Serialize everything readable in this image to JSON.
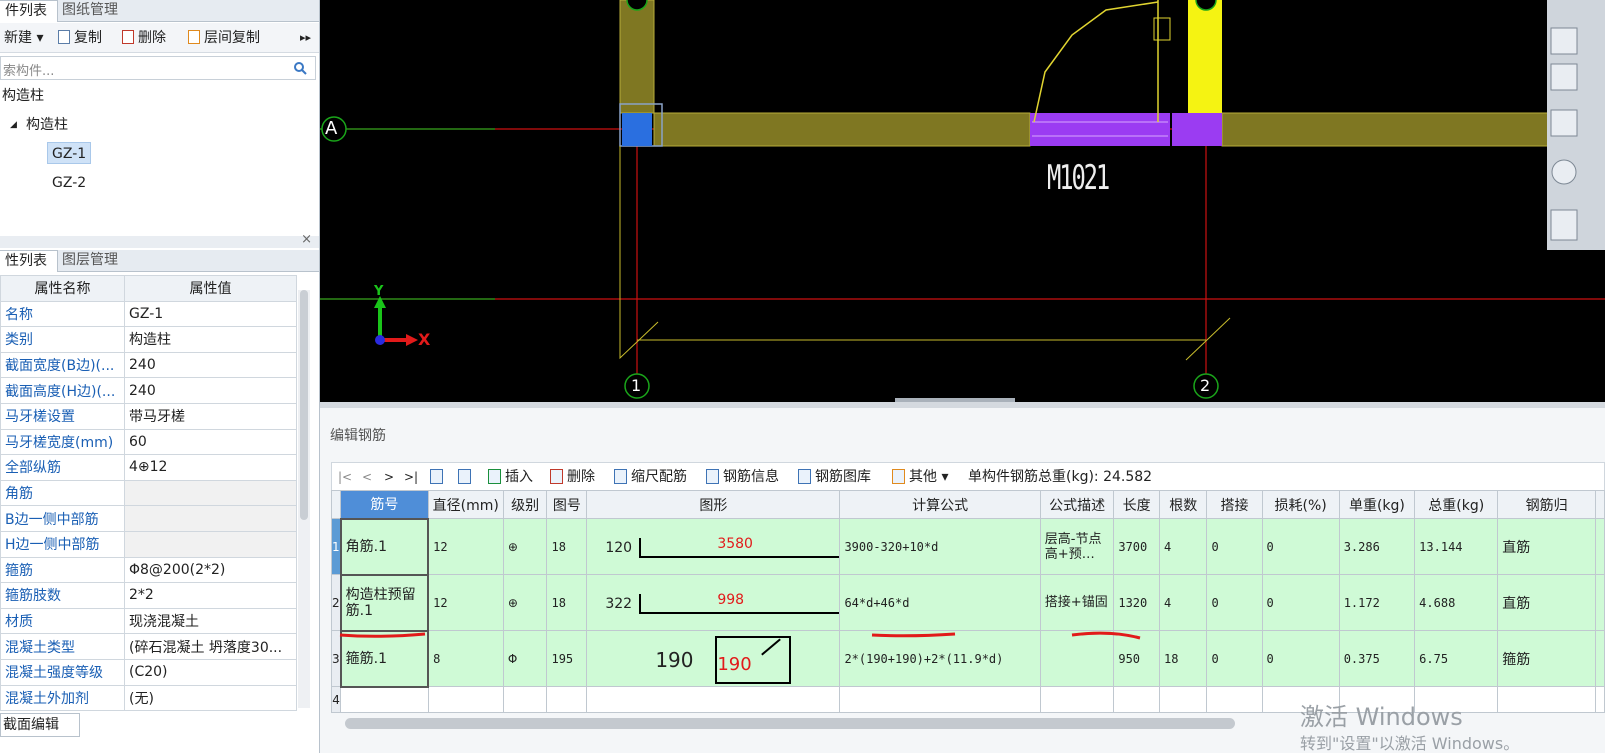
{
  "component_panel": {
    "tabs": [
      "件列表",
      "图纸管理"
    ],
    "toolbar": [
      {
        "label": "新建 ▾",
        "icon": "new-icon"
      },
      {
        "label": "复制",
        "icon": "copy-icon"
      },
      {
        "label": "删除",
        "icon": "delete-icon"
      },
      {
        "label": "层间复制",
        "icon": "floor-copy-icon"
      }
    ],
    "more": "▸▸",
    "search_placeholder": "索构件...",
    "tree": {
      "root": "构造柱",
      "group": "构造柱",
      "group_toggle": "◢",
      "items": [
        "GZ-1",
        "GZ-2"
      ]
    },
    "close": "×"
  },
  "property_panel": {
    "tabs": [
      "性列表",
      "图层管理"
    ],
    "headers": [
      "属性名称",
      "属性值"
    ],
    "rows": [
      {
        "name": "名称",
        "value": "GZ-1"
      },
      {
        "name": "类别",
        "value": "构造柱"
      },
      {
        "name": "截面宽度(B边)(...",
        "value": "240"
      },
      {
        "name": "截面高度(H边)(...",
        "value": "240"
      },
      {
        "name": "马牙槎设置",
        "value": "带马牙槎"
      },
      {
        "name": "马牙槎宽度(mm)",
        "value": "60"
      },
      {
        "name": "全部纵筋",
        "value": "4⊕12"
      },
      {
        "name": "角筋",
        "value": ""
      },
      {
        "name": "B边一侧中部筋",
        "value": ""
      },
      {
        "name": "H边一侧中部筋",
        "value": ""
      },
      {
        "name": "箍筋",
        "value": "Φ8@200(2*2)"
      },
      {
        "name": "箍筋肢数",
        "value": "2*2"
      },
      {
        "name": "材质",
        "value": "现浇混凝土"
      },
      {
        "name": "混凝土类型",
        "value": "(碎石混凝土 坍落度30..."
      },
      {
        "name": "混凝土强度等级",
        "value": "(C20)"
      },
      {
        "name": "混凝土外加剂",
        "value": "(无)"
      }
    ],
    "bottom_tab": "截面编辑"
  },
  "canvas": {
    "axis_a": "A",
    "axis_1": "1",
    "axis_2": "2",
    "door_label": "M1021",
    "ucs_x": "X",
    "ucs_y": "Y"
  },
  "rebar_editor": {
    "title": "编辑钢筋",
    "toolbar": [
      {
        "label": "|<",
        "icon": "first-icon"
      },
      {
        "label": "<",
        "icon": "prev-icon"
      },
      {
        "label": ">",
        "icon": "next-icon"
      },
      {
        "label": ">|",
        "icon": "last-icon"
      },
      {
        "label": "插入",
        "icon": "insert-icon"
      },
      {
        "label": "删除",
        "icon": "delete-icon"
      },
      {
        "label": "缩尺配筋",
        "icon": "scale-icon"
      },
      {
        "label": "钢筋信息",
        "icon": "info-icon"
      },
      {
        "label": "钢筋图库",
        "icon": "library-icon"
      },
      {
        "label": "其他 ▾",
        "icon": "other-icon"
      }
    ],
    "total_weight_label": "单构件钢筋总重(kg): 24.582",
    "columns": [
      "筋号",
      "直径(mm)",
      "级别",
      "图号",
      "图形",
      "计算公式",
      "公式描述",
      "长度",
      "根数",
      "搭接",
      "损耗(%)",
      "单重(kg)",
      "总重(kg)",
      "钢筋归"
    ],
    "rows": [
      {
        "no": "1",
        "name": "角筋.1",
        "diameter": "12",
        "grade": "⊕",
        "fig": "18",
        "shape_left": "120",
        "shape_mid": "3580",
        "formula": "3900-320+10*d",
        "desc": "层高-节点高+预…",
        "length": "3700",
        "count": "4",
        "lap": "0",
        "loss": "0",
        "unit_weight": "3.286",
        "total_weight": "13.144",
        "type": "直筋"
      },
      {
        "no": "2",
        "name": "构造柱预留筋.1",
        "diameter": "12",
        "grade": "⊕",
        "fig": "18",
        "shape_left": "322",
        "shape_mid": "998",
        "formula": "64*d+46*d",
        "desc": "搭接+锚固",
        "length": "1320",
        "count": "4",
        "lap": "0",
        "loss": "0",
        "unit_weight": "1.172",
        "total_weight": "4.688",
        "type": "直筋"
      },
      {
        "no": "3",
        "name": "箍筋.1",
        "diameter": "8",
        "grade": "Φ",
        "fig": "195",
        "shape_left": "190",
        "shape_mid": "190",
        "formula": "2*(190+190)+2*(11.9*d)",
        "desc": "",
        "length": "950",
        "count": "18",
        "lap": "0",
        "loss": "0",
        "unit_weight": "0.375",
        "total_weight": "6.75",
        "type": "箍筋"
      },
      {
        "no": "4"
      }
    ]
  },
  "watermark": {
    "line1": "激活 Windows",
    "line2": "转到\"设置\"以激活 Windows。"
  },
  "colors": {
    "wall": "#7f7722",
    "column": "#2a6fe0",
    "door": "#9b3cf2",
    "yellow_col": "#f5f312",
    "grid_red": "#cc1111",
    "grid_green": "#1aa51a",
    "row_green": "#cffad6",
    "annotation_red": "#e21a1a"
  }
}
